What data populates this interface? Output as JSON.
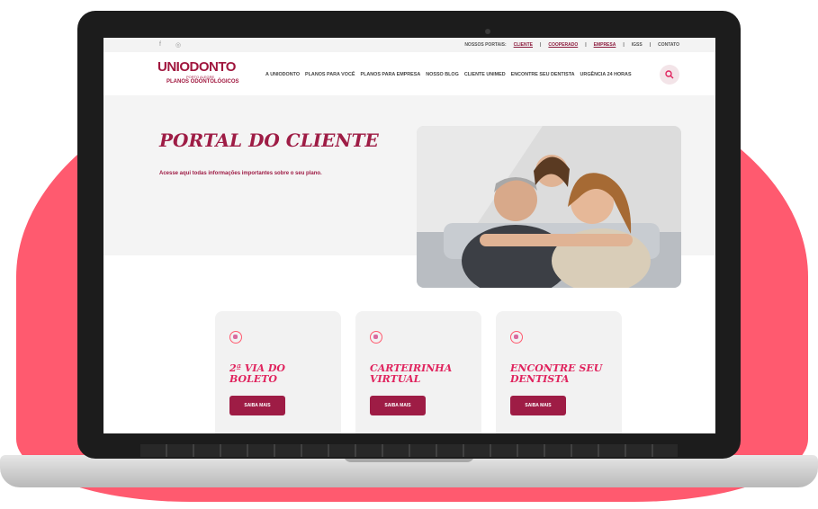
{
  "topbar": {
    "social_icons": [
      "facebook-icon",
      "instagram-icon"
    ],
    "portais_label": "NOSSOS PORTAIS:",
    "portais_links": [
      "CLIENTE",
      "COOPERADO",
      "EMPRESA"
    ],
    "extra_links": [
      "IGSS",
      "CONTATO"
    ]
  },
  "logo": {
    "brand": "UNIODONTO",
    "sub": "PORTO ALEGRE",
    "tagline": "PLANOS ODONTOLÓGICOS"
  },
  "nav": {
    "items": [
      "A UNIODONTO",
      "PLANOS PARA VOCÊ",
      "PLANOS PARA EMPRESA",
      "NOSSO BLOG",
      "CLIENTE UNIMED",
      "ENCONTRE SEU DENTISTA",
      "URGÊNCIA 24 HORAS"
    ]
  },
  "hero": {
    "title": "PORTAL DO CLIENTE",
    "subtitle": "Acesse aqui todas informações importantes sobre o seu plano."
  },
  "cards": [
    {
      "title": "2ª VIA DO BOLETO",
      "button": "SAIBA MAIS",
      "icon": "invoice-icon"
    },
    {
      "title": "CARTEIRINHA VIRTUAL",
      "button": "SAIBA MAIS",
      "icon": "card-icon"
    },
    {
      "title": "ENCONTRE SEU DENTISTA",
      "button": "SAIBA MAIS",
      "icon": "search-dentist-icon"
    }
  ],
  "colors": {
    "brand": "#9e1c45",
    "accent": "#ff5a6f",
    "card_title": "#e0245e"
  }
}
